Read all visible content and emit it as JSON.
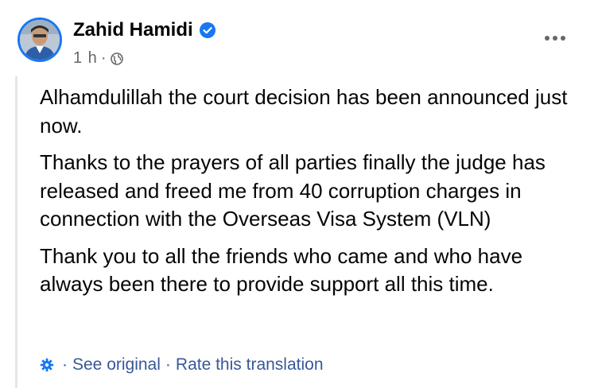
{
  "post": {
    "author": "Zahid Hamidi",
    "verified_icon": "verified-badge-icon",
    "timestamp": "1 h",
    "separator": "·",
    "privacy_icon": "globe-icon",
    "paragraphs": [
      "Alhamdulillah the court decision has been announced just now.",
      "Thanks to the prayers of all parties finally the judge has released and freed me from 40 corruption charges in connection with the Overseas Visa System (VLN)",
      "Thank you to all the friends who came and who have always been there to provide support all this time."
    ]
  },
  "translation": {
    "icon": "gear-icon",
    "separator": "·",
    "see_original": "See original",
    "rate": "Rate this translation"
  },
  "menu": {
    "icon": "more-dots-icon"
  },
  "colors": {
    "accent": "#1877f2",
    "link": "#385898",
    "muted": "#65676b",
    "text": "#050505"
  }
}
